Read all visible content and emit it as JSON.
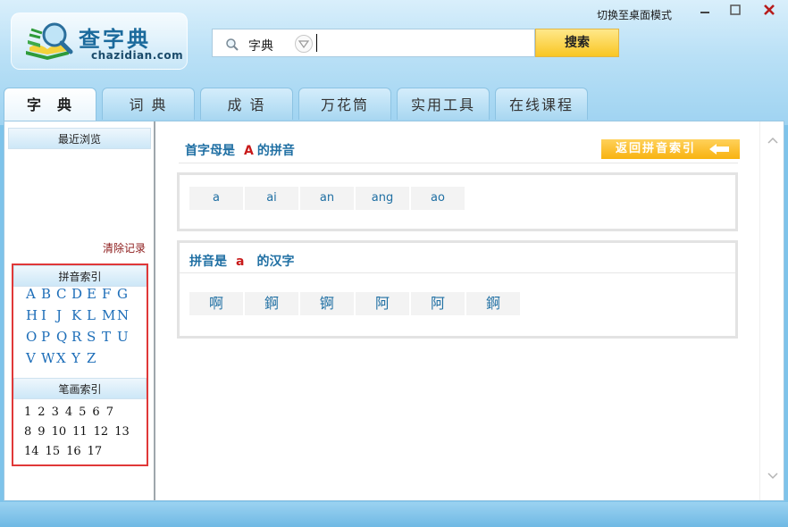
{
  "app": {
    "logo_text": "查字典",
    "logo_domain": "chazidian.com",
    "mode_link": "切换至桌面模式"
  },
  "search": {
    "scope": "字典",
    "value": "",
    "button_label": "搜索"
  },
  "tabs": [
    {
      "label": "字典",
      "active": true
    },
    {
      "label": "词 典",
      "active": false
    },
    {
      "label": "成 语",
      "active": false
    },
    {
      "label": "万花筒",
      "active": false
    },
    {
      "label": "实用工具",
      "active": false
    },
    {
      "label": "在线课程",
      "active": false
    }
  ],
  "sidebar": {
    "recent_title": "最近浏览",
    "clear_label": "清除记录",
    "pinyin_title": "拼音索引",
    "pinyin_rows": [
      [
        "A",
        "B",
        "C",
        "D",
        "E",
        "F",
        "G"
      ],
      [
        "H",
        "I",
        "J",
        "K",
        "L",
        "M",
        "N"
      ],
      [
        "O",
        "P",
        "Q",
        "R",
        "S",
        "T",
        "U"
      ],
      [
        "V",
        "W",
        "X",
        "Y",
        "Z"
      ]
    ],
    "stroke_title": "笔画索引",
    "stroke_rows": [
      [
        "1",
        "2",
        "3",
        "4",
        "5",
        "6",
        "7"
      ],
      [
        "8",
        "9",
        "10",
        "11",
        "12",
        "13"
      ],
      [
        "14",
        "15",
        "16",
        "17"
      ]
    ]
  },
  "content": {
    "first_header_prefix": "首字母是",
    "first_header_letter": "A",
    "first_header_suffix": "的拼音",
    "back_button": "返回拼音索引",
    "pinyins": [
      "a",
      "ai",
      "an",
      "ang",
      "ao"
    ],
    "chars_header_prefix": "拼音是",
    "chars_header_letter": "a",
    "chars_header_suffix": "的汉字",
    "characters": [
      "啊",
      "錒",
      "锕",
      "阿",
      "阿",
      "錒"
    ]
  },
  "colors": {
    "accent_blue": "#1f6fa3",
    "accent_red": "#c81a1a",
    "search_button": "#f9c623",
    "index_border": "#e03838"
  }
}
